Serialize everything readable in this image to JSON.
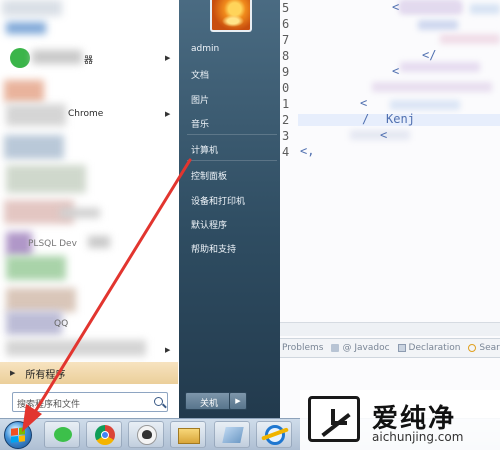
{
  "editor": {
    "line_numbers": [
      "5",
      "6",
      "7",
      "8",
      "9",
      "0",
      "1",
      "2",
      "3",
      "4"
    ],
    "fragments": [
      {
        "text": "<",
        "color": "#5070b0"
      },
      {
        "text": "</",
        "color": "#5070b0"
      },
      {
        "text": "<",
        "color": "#5070b0"
      },
      {
        "text": "<",
        "color": "#5070b0"
      },
      {
        "text": "/",
        "color": "#5070b0"
      },
      {
        "text": "Kenj",
        "color": "#5070b0"
      },
      {
        "text": "<",
        "color": "#5070b0"
      },
      {
        "text": "<,",
        "color": "#5070b0"
      }
    ],
    "bottom_tabs": [
      {
        "label": "Problems",
        "icon": "problems-icon"
      },
      {
        "label": "@ Javadoc",
        "icon": "javadoc-icon"
      },
      {
        "label": "Declaration",
        "icon": "declaration-icon"
      },
      {
        "label": "Search",
        "icon": "search-icon"
      }
    ]
  },
  "start_menu": {
    "programs": [
      {
        "label": "",
        "icon": "blurred-app-icon"
      },
      {
        "label": "器",
        "icon": "green-app-icon"
      },
      {
        "label": "",
        "icon": "blurred-app-icon"
      },
      {
        "label": "Chrome",
        "icon": "chrome-icon"
      },
      {
        "label": "",
        "icon": "blurred-app-icon"
      },
      {
        "label": "",
        "icon": "blurred-app-icon"
      },
      {
        "label": "",
        "icon": "blurred-app-icon"
      },
      {
        "label": "PLSQL Dev",
        "icon": "plsql-icon"
      },
      {
        "label": "",
        "icon": "blurred-app-icon"
      },
      {
        "label": "",
        "icon": "blurred-app-icon"
      },
      {
        "label": "QQ",
        "icon": "qq-icon"
      }
    ],
    "all_programs": "所有程序",
    "search_placeholder": "搜索程序和文件",
    "user_name": "admin",
    "right_items": [
      "文档",
      "图片",
      "音乐",
      "计算机",
      "控制面板",
      "设备和打印机",
      "默认程序",
      "帮助和支持"
    ],
    "shutdown_label": "关机"
  },
  "taskbar": {
    "items": [
      "start-orb-icon",
      "wechat-icon",
      "chrome-icon",
      "user-app-icon",
      "file-explorer-icon",
      "app-icon",
      "ie-icon"
    ]
  },
  "watermark": {
    "title": "爱纯净",
    "subtitle": "aichunjing.com"
  },
  "colors": {
    "start_right_top": "#4a6b82",
    "start_right_bottom": "#223a4d",
    "all_programs_bg": "#ebcf9a",
    "arrow_red": "#e2352f"
  }
}
